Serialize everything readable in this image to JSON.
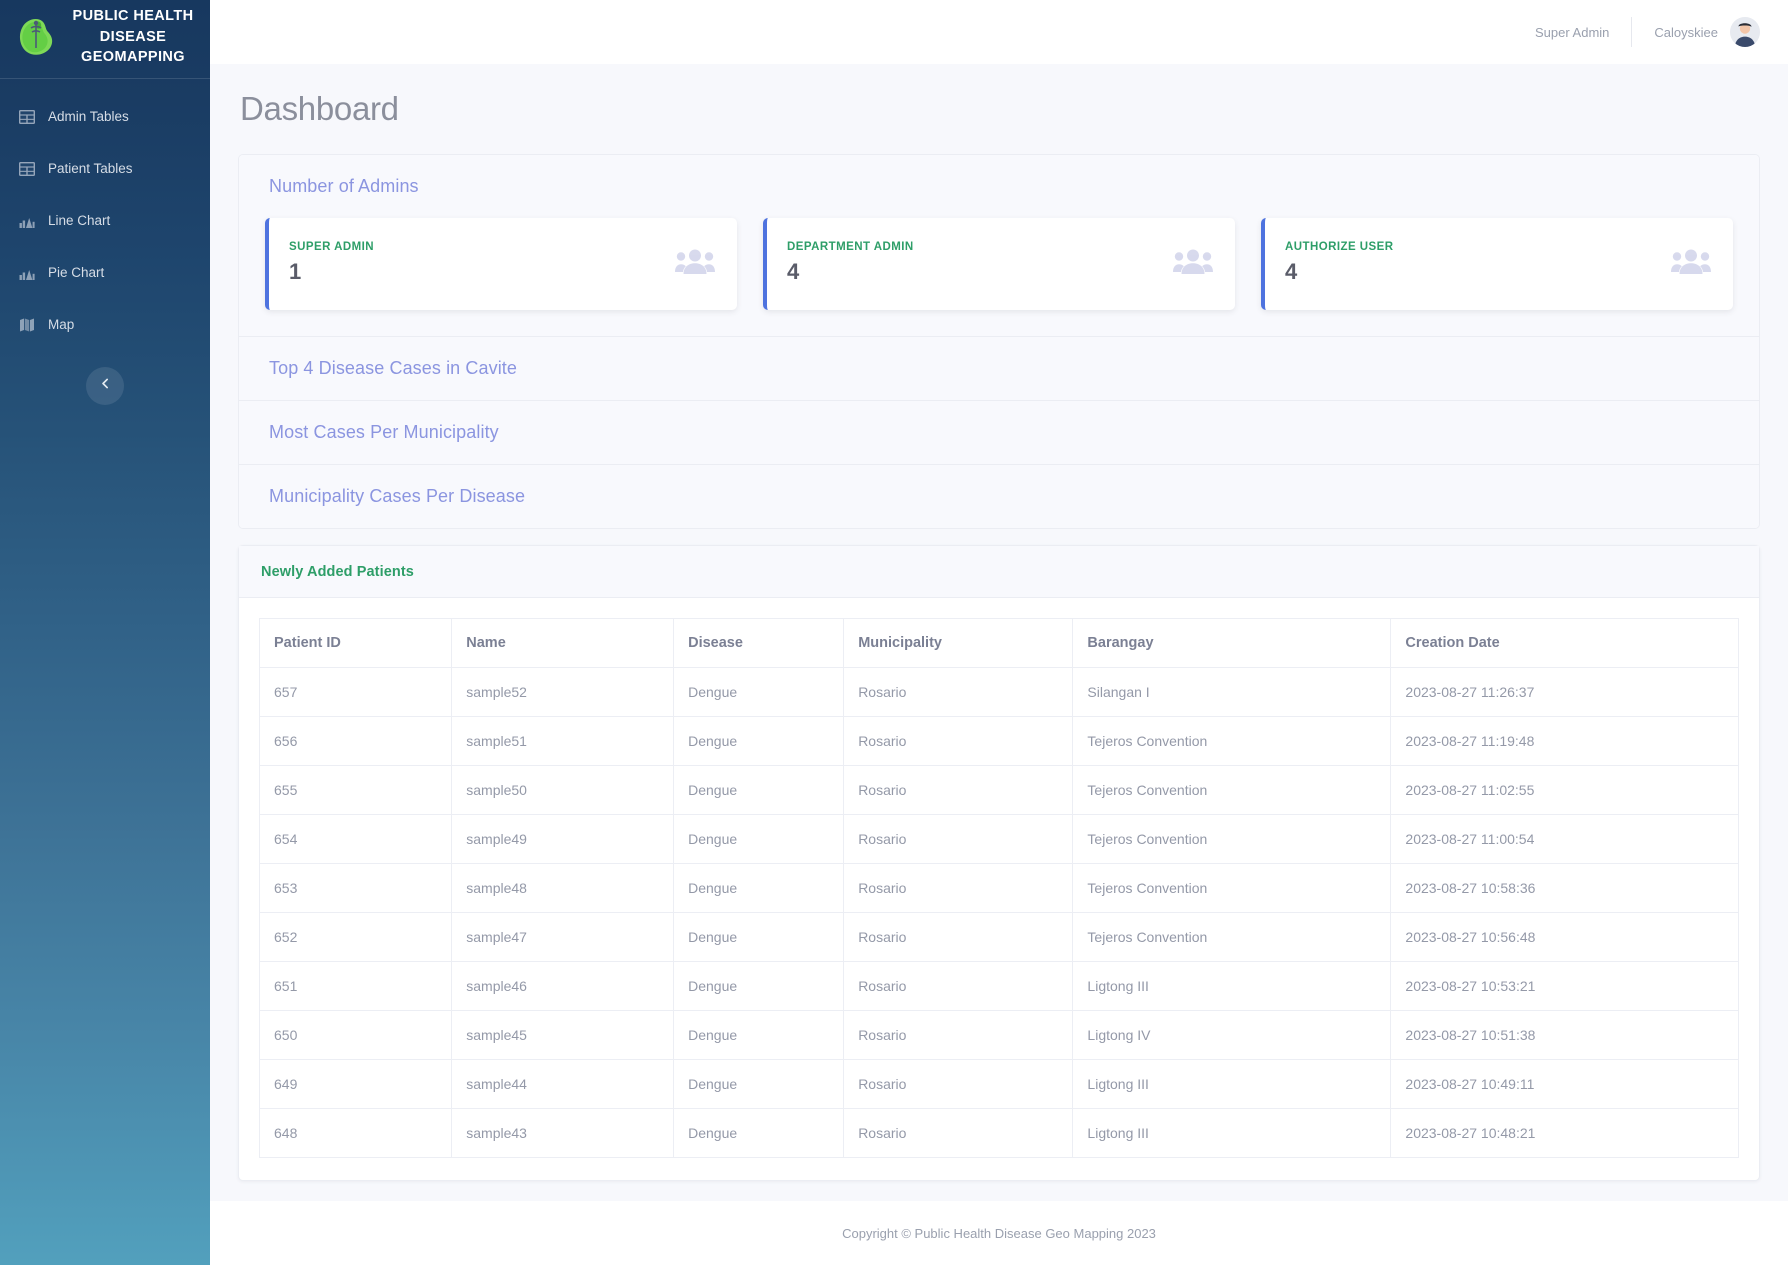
{
  "sidebar": {
    "brand_title": "PUBLIC HEALTH DISEASE GEOMAPPING",
    "items": [
      {
        "label": "Admin Tables",
        "icon": "table-icon"
      },
      {
        "label": "Patient Tables",
        "icon": "table-icon"
      },
      {
        "label": "Line Chart",
        "icon": "bar-chart-icon"
      },
      {
        "label": "Pie Chart",
        "icon": "bar-chart-icon"
      },
      {
        "label": "Map",
        "icon": "map-icon"
      }
    ],
    "collapse_icon": "chevron-left-icon"
  },
  "topbar": {
    "role": "Super Admin",
    "username": "Caloyskiee"
  },
  "page": {
    "title": "Dashboard"
  },
  "panels": [
    {
      "title": "Number of Admins",
      "expanded": true
    },
    {
      "title": "Top 4 Disease Cases in Cavite",
      "expanded": false
    },
    {
      "title": "Most Cases Per Municipality",
      "expanded": false
    },
    {
      "title": "Municipality Cases Per Disease",
      "expanded": false
    }
  ],
  "stat_cards": [
    {
      "label": "SUPER ADMIN",
      "value": "1",
      "accent": "#4e73df",
      "icon": "users-icon"
    },
    {
      "label": "DEPARTMENT ADMIN",
      "value": "4",
      "accent": "#4e73df",
      "icon": "users-icon"
    },
    {
      "label": "AUTHORIZE USER",
      "value": "4",
      "accent": "#4e73df",
      "icon": "users-icon"
    }
  ],
  "patients": {
    "title": "Newly Added Patients",
    "columns": [
      "Patient ID",
      "Name",
      "Disease",
      "Municipality",
      "Barangay",
      "Creation Date"
    ],
    "rows": [
      [
        "657",
        "sample52",
        "Dengue",
        "Rosario",
        "Silangan I",
        "2023-08-27 11:26:37"
      ],
      [
        "656",
        "sample51",
        "Dengue",
        "Rosario",
        "Tejeros Convention",
        "2023-08-27 11:19:48"
      ],
      [
        "655",
        "sample50",
        "Dengue",
        "Rosario",
        "Tejeros Convention",
        "2023-08-27 11:02:55"
      ],
      [
        "654",
        "sample49",
        "Dengue",
        "Rosario",
        "Tejeros Convention",
        "2023-08-27 11:00:54"
      ],
      [
        "653",
        "sample48",
        "Dengue",
        "Rosario",
        "Tejeros Convention",
        "2023-08-27 10:58:36"
      ],
      [
        "652",
        "sample47",
        "Dengue",
        "Rosario",
        "Tejeros Convention",
        "2023-08-27 10:56:48"
      ],
      [
        "651",
        "sample46",
        "Dengue",
        "Rosario",
        "Ligtong III",
        "2023-08-27 10:53:21"
      ],
      [
        "650",
        "sample45",
        "Dengue",
        "Rosario",
        "Ligtong IV",
        "2023-08-27 10:51:38"
      ],
      [
        "649",
        "sample44",
        "Dengue",
        "Rosario",
        "Ligtong III",
        "2023-08-27 10:49:11"
      ],
      [
        "648",
        "sample43",
        "Dengue",
        "Rosario",
        "Ligtong III",
        "2023-08-27 10:48:21"
      ]
    ]
  },
  "footer": {
    "copyright": "Copyright © Public Health Disease Geo Mapping 2023"
  },
  "colors": {
    "panel_title": "#8b95e0",
    "stat_label_green": "#2e9e68",
    "sidebar_top": "#17385f",
    "sidebar_bottom": "#52a0bd",
    "accent_blue": "#4e73df"
  }
}
